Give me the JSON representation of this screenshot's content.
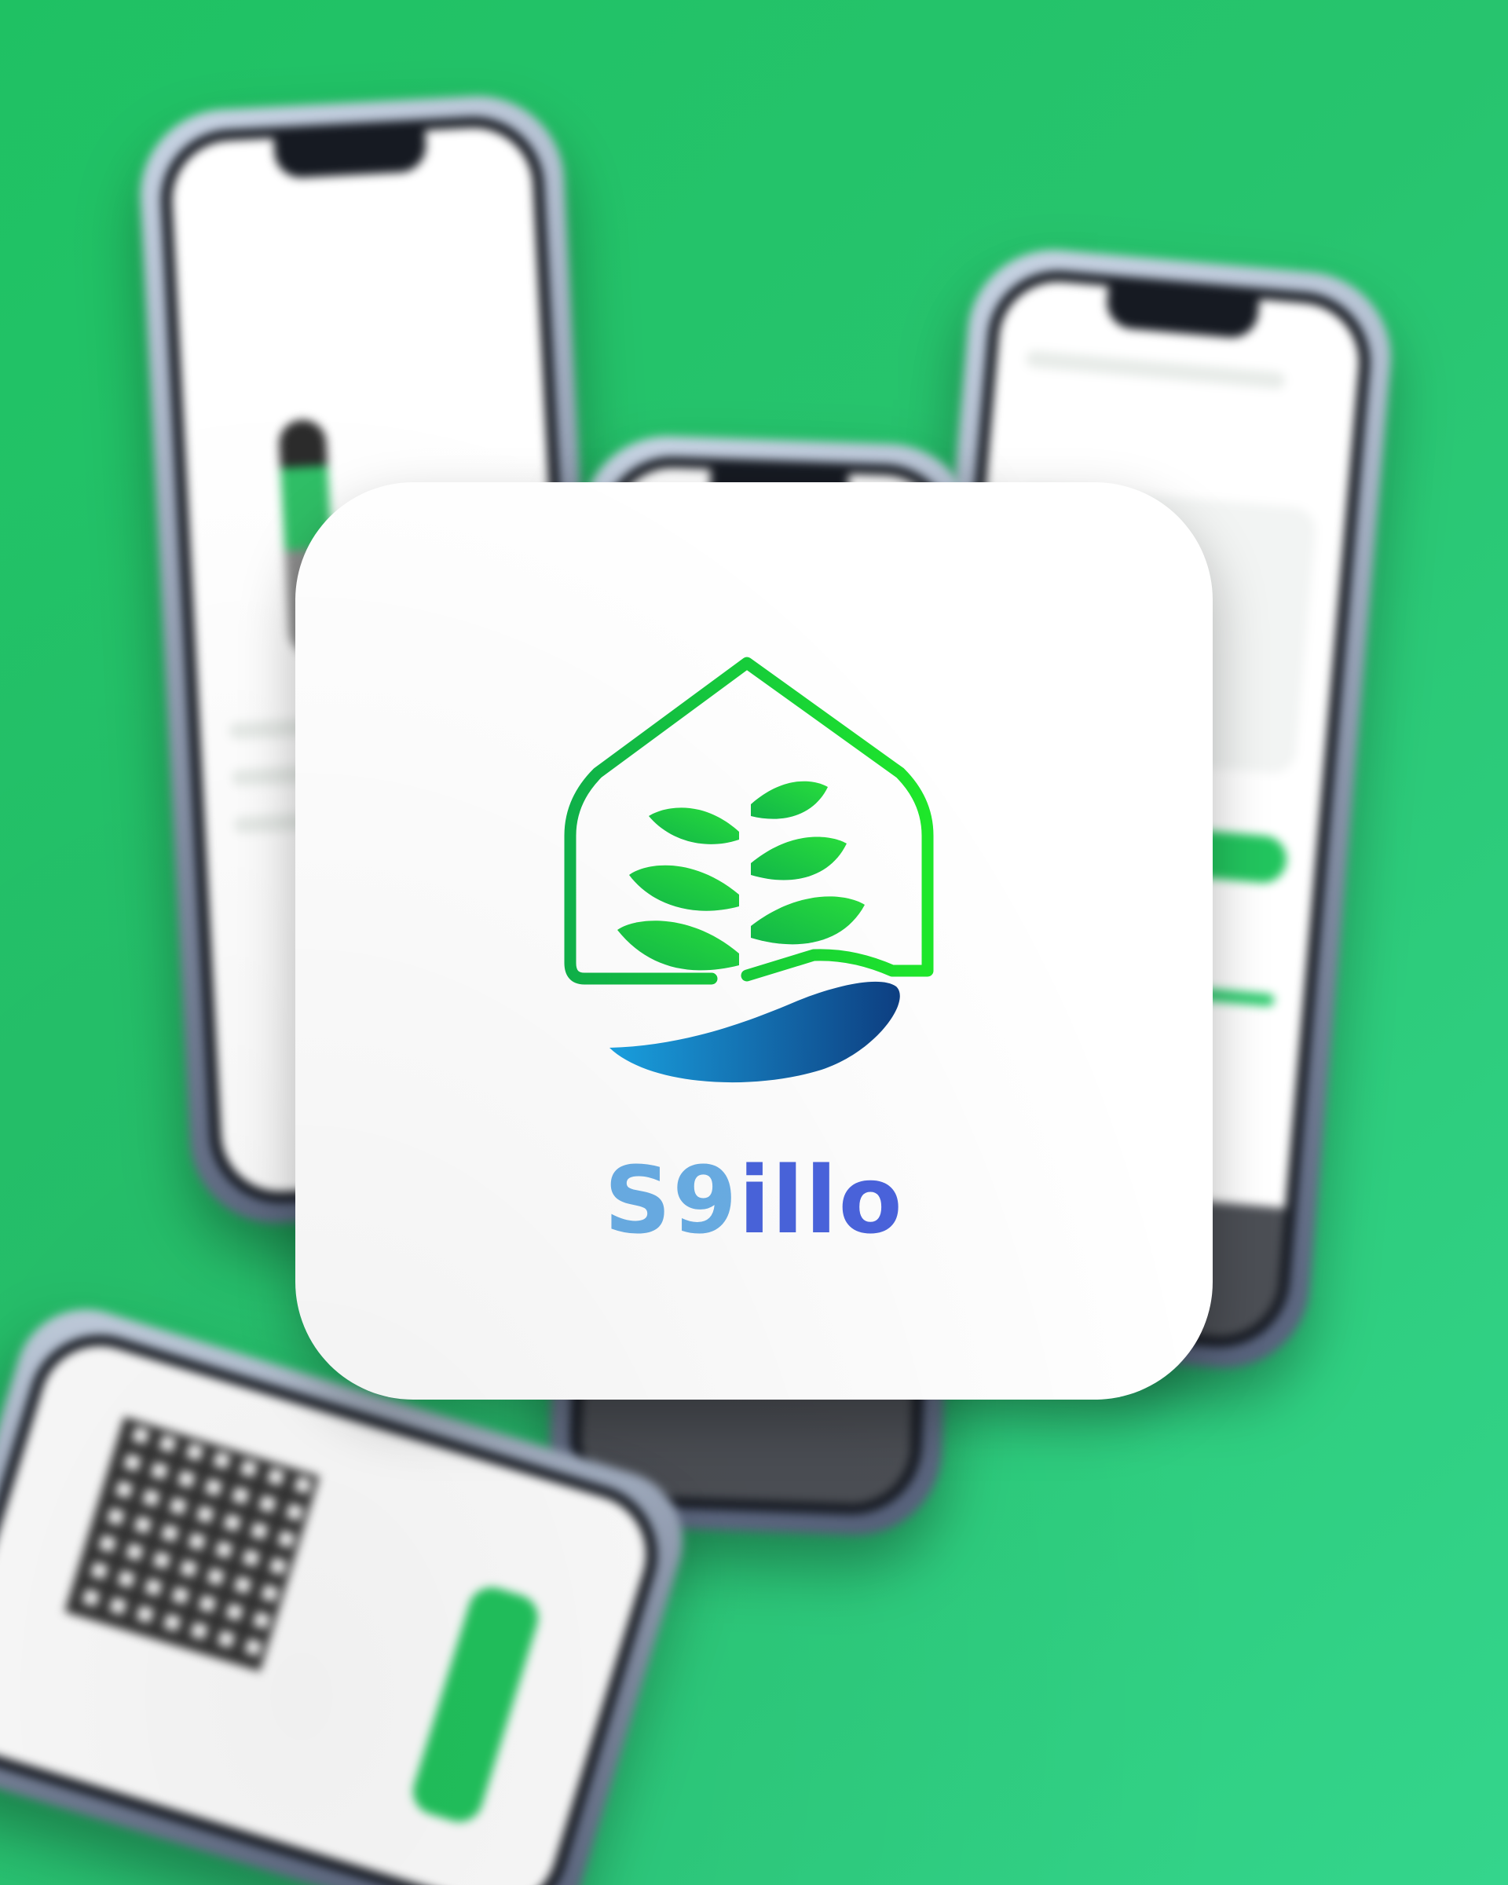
{
  "brand": {
    "name": "S9illo",
    "name_part_1": "S9",
    "name_part_2": "illo"
  },
  "colors": {
    "background_green": "#22c55e",
    "leaf_green_dark": "#0fb34a",
    "leaf_green_light": "#1ee82a",
    "water_blue_light": "#1aa3e3",
    "water_blue_dark": "#0d3f82",
    "wordmark_light_blue": "#6aaee6",
    "wordmark_indigo": "#4a64dd"
  },
  "icons": {
    "logo": "plant-in-water-drop-icon"
  }
}
